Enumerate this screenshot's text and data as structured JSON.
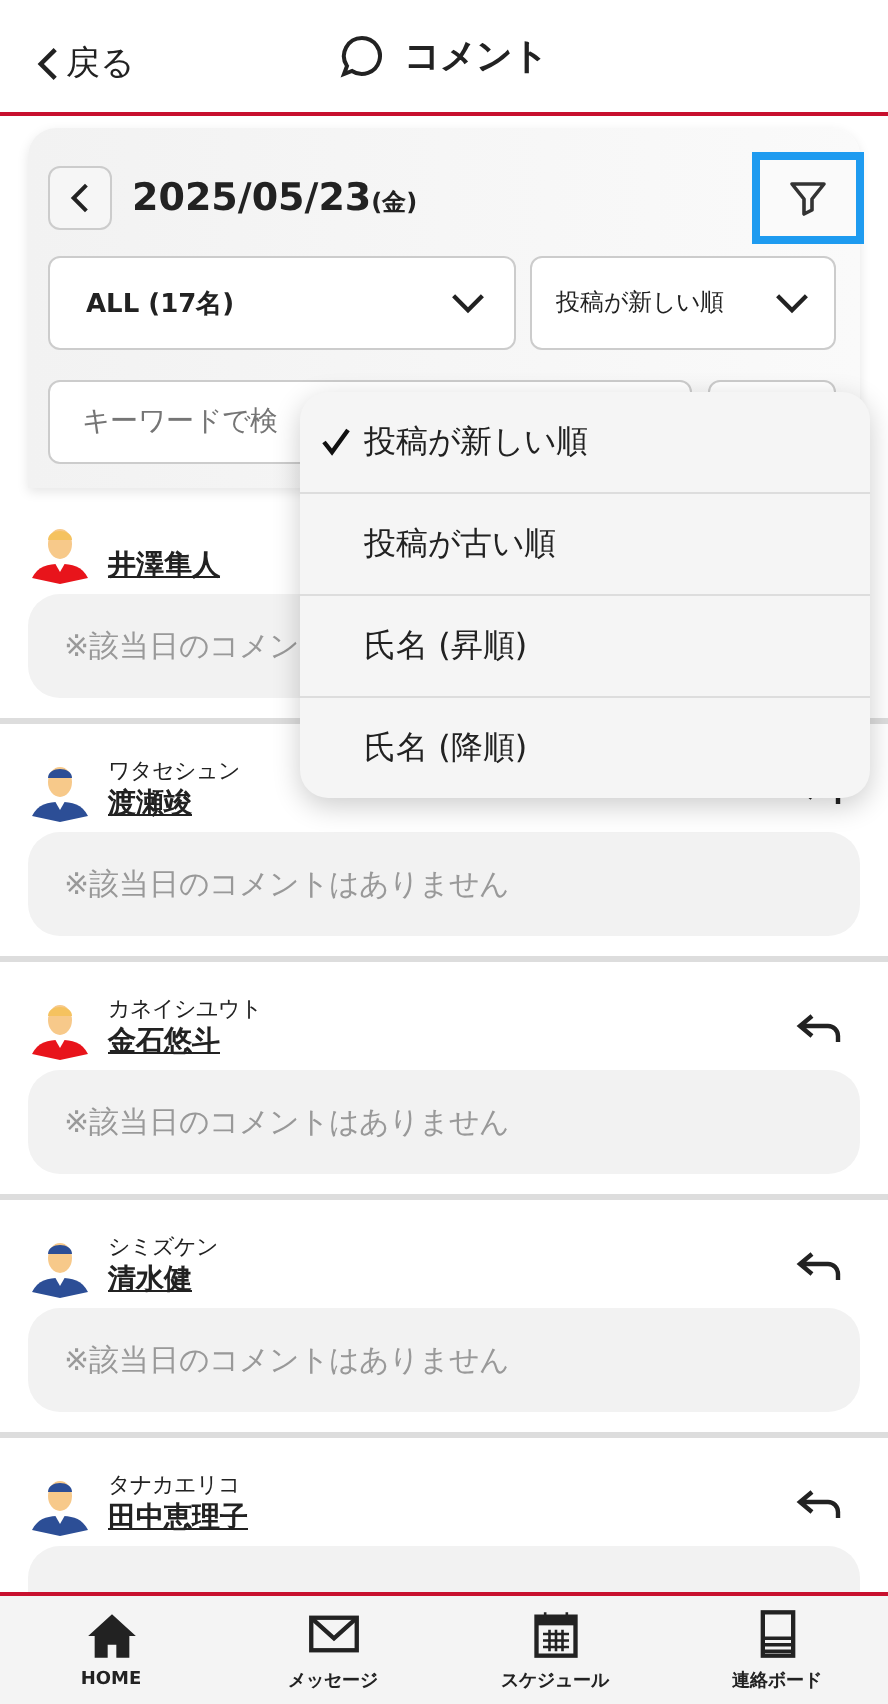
{
  "header": {
    "back": "戻る",
    "title": "コメント"
  },
  "filter": {
    "date": "2025/05/23",
    "weekday": "(金)",
    "group": "ALL (17名)",
    "sort": "投稿が新しい順",
    "search_placeholder": "キーワードで検"
  },
  "sort_menu": [
    {
      "label": "投稿が新しい順",
      "selected": true
    },
    {
      "label": "投稿が古い順",
      "selected": false
    },
    {
      "label": "氏名 (昇順)",
      "selected": false
    },
    {
      "label": "氏名 (降順)",
      "selected": false
    }
  ],
  "members": [
    {
      "name": "井澤隼人",
      "color": "#e8141b",
      "comment": "※該当日のコメン"
    },
    {
      "kana": "ワタセシュン",
      "name": "渡瀬竣",
      "color": "#2c4e96",
      "reply": true,
      "comment": "※該当日のコメントはありません"
    },
    {
      "kana": "カネイシユウト",
      "name": "金石悠斗",
      "color": "#e8141b",
      "reply": true,
      "comment": "※該当日のコメントはありません"
    },
    {
      "kana": "シミズケン",
      "name": "清水健",
      "color": "#2c4e96",
      "reply": true,
      "comment": "※該当日のコメントはありません"
    },
    {
      "kana": "タナカエリコ",
      "name": "田中恵理子",
      "color": "#2c4e96",
      "reply": true
    }
  ],
  "nav": [
    {
      "kind": "home",
      "label": "HOME"
    },
    {
      "kind": "mail",
      "label": "メッセージ"
    },
    {
      "kind": "calendar",
      "label": "スケジュール"
    },
    {
      "kind": "board",
      "label": "連絡ボード"
    }
  ]
}
